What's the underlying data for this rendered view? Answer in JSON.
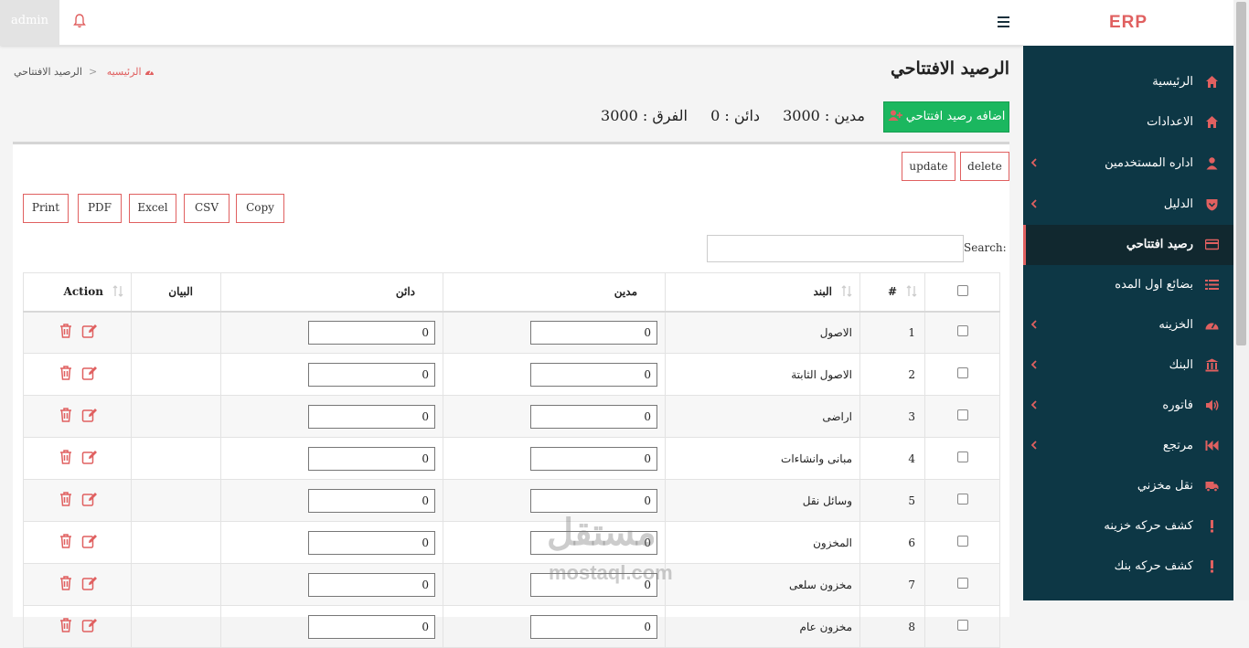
{
  "topbar": {
    "user": "admin"
  },
  "brand": "ERP",
  "sidebar": {
    "items": [
      {
        "label": "الرئيسية",
        "icon": "home-icon",
        "chevron": false,
        "active": false
      },
      {
        "label": "الاعدادات",
        "icon": "home-icon",
        "chevron": false,
        "active": false
      },
      {
        "label": "اداره المستخدمين",
        "icon": "user-icon",
        "chevron": true,
        "active": false
      },
      {
        "label": "الدليل",
        "icon": "shield-icon",
        "chevron": true,
        "active": false
      },
      {
        "label": "رصيد افتتاحي",
        "icon": "card-icon",
        "chevron": false,
        "active": true
      },
      {
        "label": "بضائع اول المده",
        "icon": "list-icon",
        "chevron": false,
        "active": false
      },
      {
        "label": "الخزينه",
        "icon": "gauge-icon",
        "chevron": true,
        "active": false
      },
      {
        "label": "البنك",
        "icon": "bank-icon",
        "chevron": true,
        "active": false
      },
      {
        "label": "فاتوره",
        "icon": "volume-icon",
        "chevron": true,
        "active": false
      },
      {
        "label": "مرتجع",
        "icon": "backward-icon",
        "chevron": true,
        "active": false
      },
      {
        "label": "نقل مخزني",
        "icon": "truck-icon",
        "chevron": false,
        "active": false
      },
      {
        "label": "كشف حركه خزينه",
        "icon": "exclamation-icon",
        "chevron": false,
        "active": false
      },
      {
        "label": "كشف حركه بنك",
        "icon": "exclamation-icon",
        "chevron": false,
        "active": false
      }
    ]
  },
  "page": {
    "title": "الرصيد الافتتاحي",
    "breadcrumb_home": "الرئيسيه",
    "breadcrumb_current": "الرصيد الافتتاحي",
    "add_button": "اضافه رصيد افتتاحي",
    "totals": {
      "debit": "مدين : 3000",
      "credit": "دائن : 0",
      "diff": "الفرق : 3000"
    }
  },
  "actions": {
    "delete": "delete",
    "update": "update"
  },
  "export_buttons": [
    "Print",
    "PDF",
    "Excel",
    "CSV",
    "Copy"
  ],
  "search": {
    "label": "Search:",
    "value": ""
  },
  "table": {
    "headers": {
      "num": "#",
      "item": "البند",
      "debit": "مدين",
      "credit": "دائن",
      "statement": "البيان",
      "action": "Action"
    },
    "rows": [
      {
        "num": "1",
        "item": "الاصول",
        "debit": "0",
        "credit": "0"
      },
      {
        "num": "2",
        "item": "الاصول الثابتة",
        "debit": "0",
        "credit": "0"
      },
      {
        "num": "3",
        "item": "اراضى",
        "debit": "0",
        "credit": "0"
      },
      {
        "num": "4",
        "item": "مبانى وانشاءات",
        "debit": "0",
        "credit": "0"
      },
      {
        "num": "5",
        "item": "وسائل نقل",
        "debit": "0",
        "credit": "0"
      },
      {
        "num": "6",
        "item": "المخزون",
        "debit": "0",
        "credit": "0"
      },
      {
        "num": "7",
        "item": "مخزون سلعى",
        "debit": "0",
        "credit": "0"
      },
      {
        "num": "8",
        "item": "مخزون عام",
        "debit": "0",
        "credit": "0"
      }
    ]
  },
  "watermark": {
    "arabic": "مستقل",
    "latin": "mostaql.com"
  },
  "colors": {
    "accent": "#e06060",
    "sidebar": "#0d3745",
    "success": "#1bb75f"
  }
}
